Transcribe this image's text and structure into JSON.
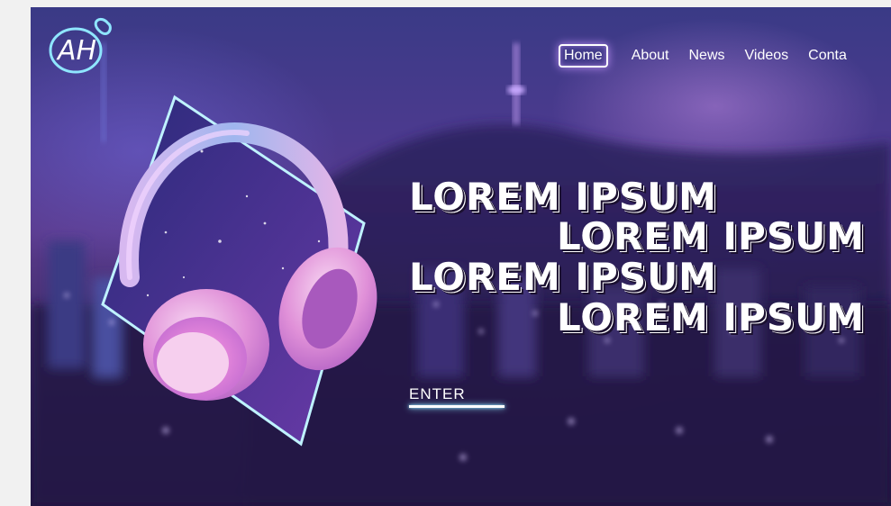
{
  "logo": {
    "text": "AH",
    "icon": "ah-neon-logo"
  },
  "nav": {
    "items": [
      {
        "label": "Home",
        "active": true
      },
      {
        "label": "About"
      },
      {
        "label": "News"
      },
      {
        "label": "Videos"
      },
      {
        "label": "Conta"
      }
    ]
  },
  "hero": {
    "headline_lines": [
      "LOREM IPSUM",
      "LOREM IPSUM",
      "LOREM IPSUM",
      "LOREM IPSUM"
    ],
    "cta_label": "ENTER",
    "illustration": "headphones-in-neon-diamond"
  },
  "colors": {
    "neon_cyan": "#8fe6ff",
    "neon_purple": "#c89bff",
    "bg_deep": "#1f1640"
  }
}
